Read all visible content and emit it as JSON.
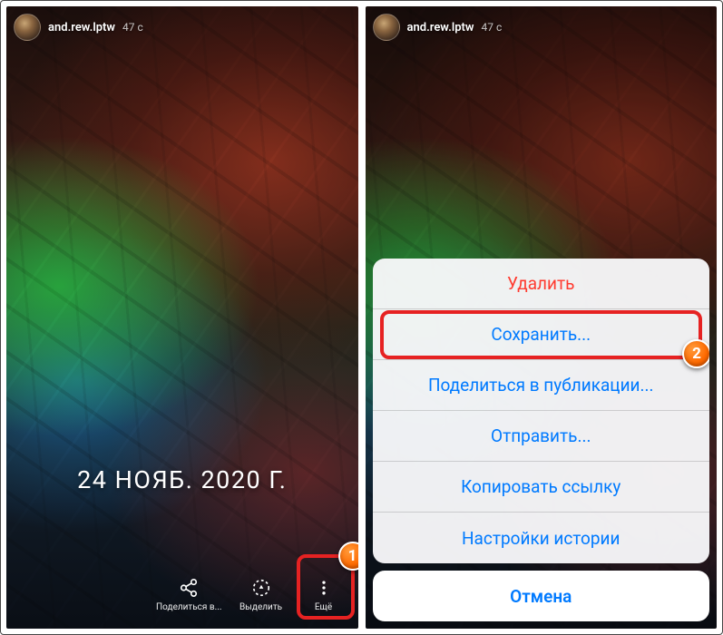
{
  "left": {
    "username": "and.rew.lptw",
    "timestamp": "47 с",
    "date_stamp": "24 НОЯБ. 2020 Г.",
    "actions": {
      "share": "Поделиться в...",
      "highlight": "Выделить",
      "more": "Ещё"
    },
    "marker": "1"
  },
  "right": {
    "username": "and.rew.lptw",
    "timestamp": "47 с",
    "sheet": {
      "delete": "Удалить",
      "save": "Сохранить...",
      "share_post": "Поделиться в публикации...",
      "send": "Отправить...",
      "copy_link": "Копировать ссылку",
      "story_settings": "Настройки истории",
      "cancel": "Отмена"
    },
    "marker": "2"
  }
}
